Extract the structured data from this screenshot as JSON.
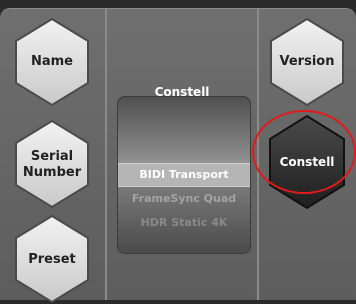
{
  "left_column": {
    "buttons": [
      {
        "label": "Name"
      },
      {
        "label": "Serial\nNumber"
      },
      {
        "label": "Preset"
      }
    ]
  },
  "center": {
    "title": "Constell",
    "picker": {
      "options": [
        "BIDI Transport",
        "FrameSync Quad",
        "HDR Static 4K"
      ],
      "selected": "BIDI Transport"
    }
  },
  "right_column": {
    "version_label": "Version",
    "value_label": "Constell"
  },
  "colors": {
    "highlight_ring": "#e11b1b",
    "button_fill_light": "#e6e6e6",
    "button_fill_dark": "#2f2f2f"
  }
}
